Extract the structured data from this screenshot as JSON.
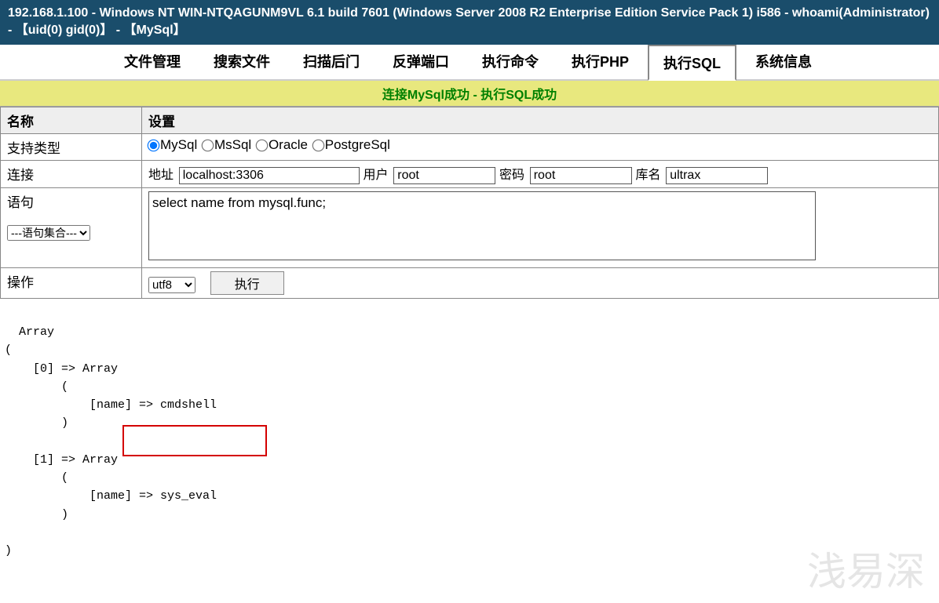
{
  "header": {
    "title": "192.168.1.100 - Windows NT WIN-NTQAGUNM9VL 6.1 build 7601 (Windows Server 2008 R2 Enterprise Edition Service Pack 1) i586 - whoami(Administrator) - 【uid(0) gid(0)】 - 【MySql】"
  },
  "tabs": {
    "items": [
      {
        "label": "文件管理",
        "active": false
      },
      {
        "label": "搜索文件",
        "active": false
      },
      {
        "label": "扫描后门",
        "active": false
      },
      {
        "label": "反弹端口",
        "active": false
      },
      {
        "label": "执行命令",
        "active": false
      },
      {
        "label": "执行PHP",
        "active": false
      },
      {
        "label": "执行SQL",
        "active": true
      },
      {
        "label": "系统信息",
        "active": false
      }
    ]
  },
  "status": {
    "text": "连接MySql成功 - 执行SQL成功"
  },
  "form": {
    "col_name": "名称",
    "col_settings": "设置",
    "row_type_label": "支持类型",
    "db_types": [
      "MySql",
      "MsSql",
      "Oracle",
      "PostgreSql"
    ],
    "db_type_selected": "MySql",
    "row_conn_label": "连接",
    "conn": {
      "addr_label": "地址",
      "addr_value": "localhost:3306",
      "user_label": "用户",
      "user_value": "root",
      "pass_label": "密码",
      "pass_value": "root",
      "db_label": "库名",
      "db_value": "ultrax"
    },
    "row_stmt_label": "语句",
    "stmt_select_placeholder": "---语句集合---",
    "sql_value": "select name from mysql.func;",
    "row_op_label": "操作",
    "charset_value": "utf8",
    "exec_button": "执行"
  },
  "output": {
    "text": "Array\n(\n    [0] => Array\n        (\n            [name] => cmdshell\n        )\n\n    [1] => Array\n        (\n            [name] => sys_eval\n        )\n\n)"
  },
  "watermark": "浅易深"
}
